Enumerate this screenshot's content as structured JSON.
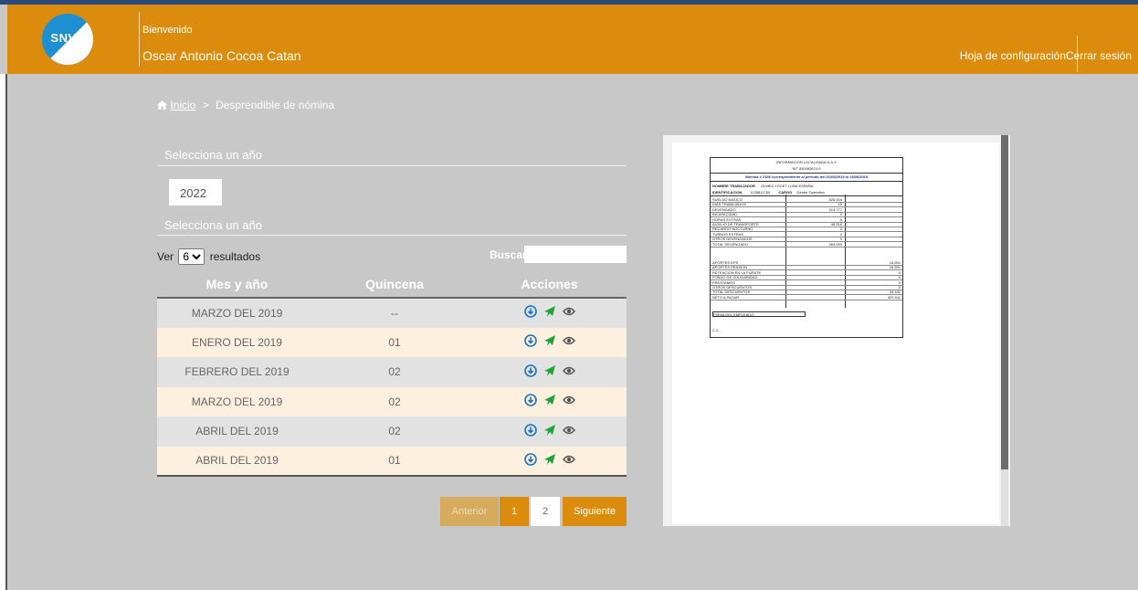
{
  "header": {
    "logo_text": "SNVA",
    "welcome": "Bienvenido",
    "user_name": "Oscar Antonio Cocoa Catan",
    "config_link": "Hoja de configuración",
    "logout_link": "Cerrar sesión"
  },
  "breadcrumb": {
    "home": "Inicio",
    "separator": ">",
    "current": "Desprendible de nómina"
  },
  "filters": {
    "year_label": "Selecciona un año",
    "year_value": "2022",
    "year_label2": "Selecciona un año",
    "show_prefix": "Ver",
    "show_value": "6",
    "show_suffix": "resultados",
    "search_label": "Buscar"
  },
  "table": {
    "headers": [
      "Mes y año",
      "Quincena",
      "Acciones"
    ],
    "rows": [
      {
        "month": "MARZO DEL 2019",
        "fortnight": "--"
      },
      {
        "month": "ENERO DEL 2019",
        "fortnight": "01"
      },
      {
        "month": "FEBRERO DEL 2019",
        "fortnight": "02"
      },
      {
        "month": "MARZO DEL 2019",
        "fortnight": "02"
      },
      {
        "month": "ABRIL DEL 2019",
        "fortnight": "02"
      },
      {
        "month": "ABRIL DEL 2019",
        "fortnight": "01"
      }
    ]
  },
  "pagination": {
    "prev": "Anterior",
    "page1": "1",
    "page2": "2",
    "next": "Siguiente"
  },
  "colors": {
    "brand": "#dc8c0c",
    "background": "#c8c8c8",
    "row_odd": "#e2e2e2",
    "row_even": "#fdf0df"
  },
  "document": {
    "company": "INFORMACION LOCALIZADA S.A.S",
    "nit": "NIT 830082674-0",
    "title": "Nómina # 2186 correspondiente al periodo del 01/06/2019 al 15/06/2019",
    "worker_label": "NOMBRE TRABAJADOR",
    "worker": "OLMES YOCET LUNA ESPAÑA",
    "id_label": "IDENTIFICACION",
    "id": "1139811760",
    "role_label": "CARGO",
    "role": "Gestor Operativo",
    "earnings": [
      {
        "label": "SUELDO BASICO",
        "value": "828.004"
      },
      {
        "label": "DIAS TRABAJADOS",
        "value": "15"
      },
      {
        "label": "DEVENGADO",
        "value": "414.777"
      },
      {
        "label": "INCAPACIDAD",
        "value": "0"
      },
      {
        "label": "HORAS EXTRAS",
        "value": "0"
      },
      {
        "label": "AUXILIO DE TRANSPORTE",
        "value": "48.516"
      },
      {
        "label": "RECARGO NOCTURNO",
        "value": "0"
      },
      {
        "label": "TURNOS EXTRAS",
        "value": "0"
      },
      {
        "label": "OTROS DEVENGADOS",
        "value": "0"
      },
      {
        "label": "TOTAL DEVENGADO",
        "value": "463.093"
      }
    ],
    "deductions": [
      {
        "label": "APORTES EPS",
        "value": "16.591"
      },
      {
        "label": "APORTES PENSION",
        "value": "16.591"
      },
      {
        "label": "RETENCION EN LA FUENTE",
        "value": "0"
      },
      {
        "label": "FONDO DE SOLIDARIDAD",
        "value": "0"
      },
      {
        "label": "PRESTAMOS",
        "value": "0"
      },
      {
        "label": "OTROS DESCUENTOS",
        "value": "0"
      },
      {
        "label": "TOTAL DESCUENTOS",
        "value": "33.182"
      },
      {
        "label": "NETO A PAGAR",
        "value": "429.911"
      }
    ],
    "signature": "FIRMA DEL EMPLEADO",
    "cc": "C.C."
  }
}
